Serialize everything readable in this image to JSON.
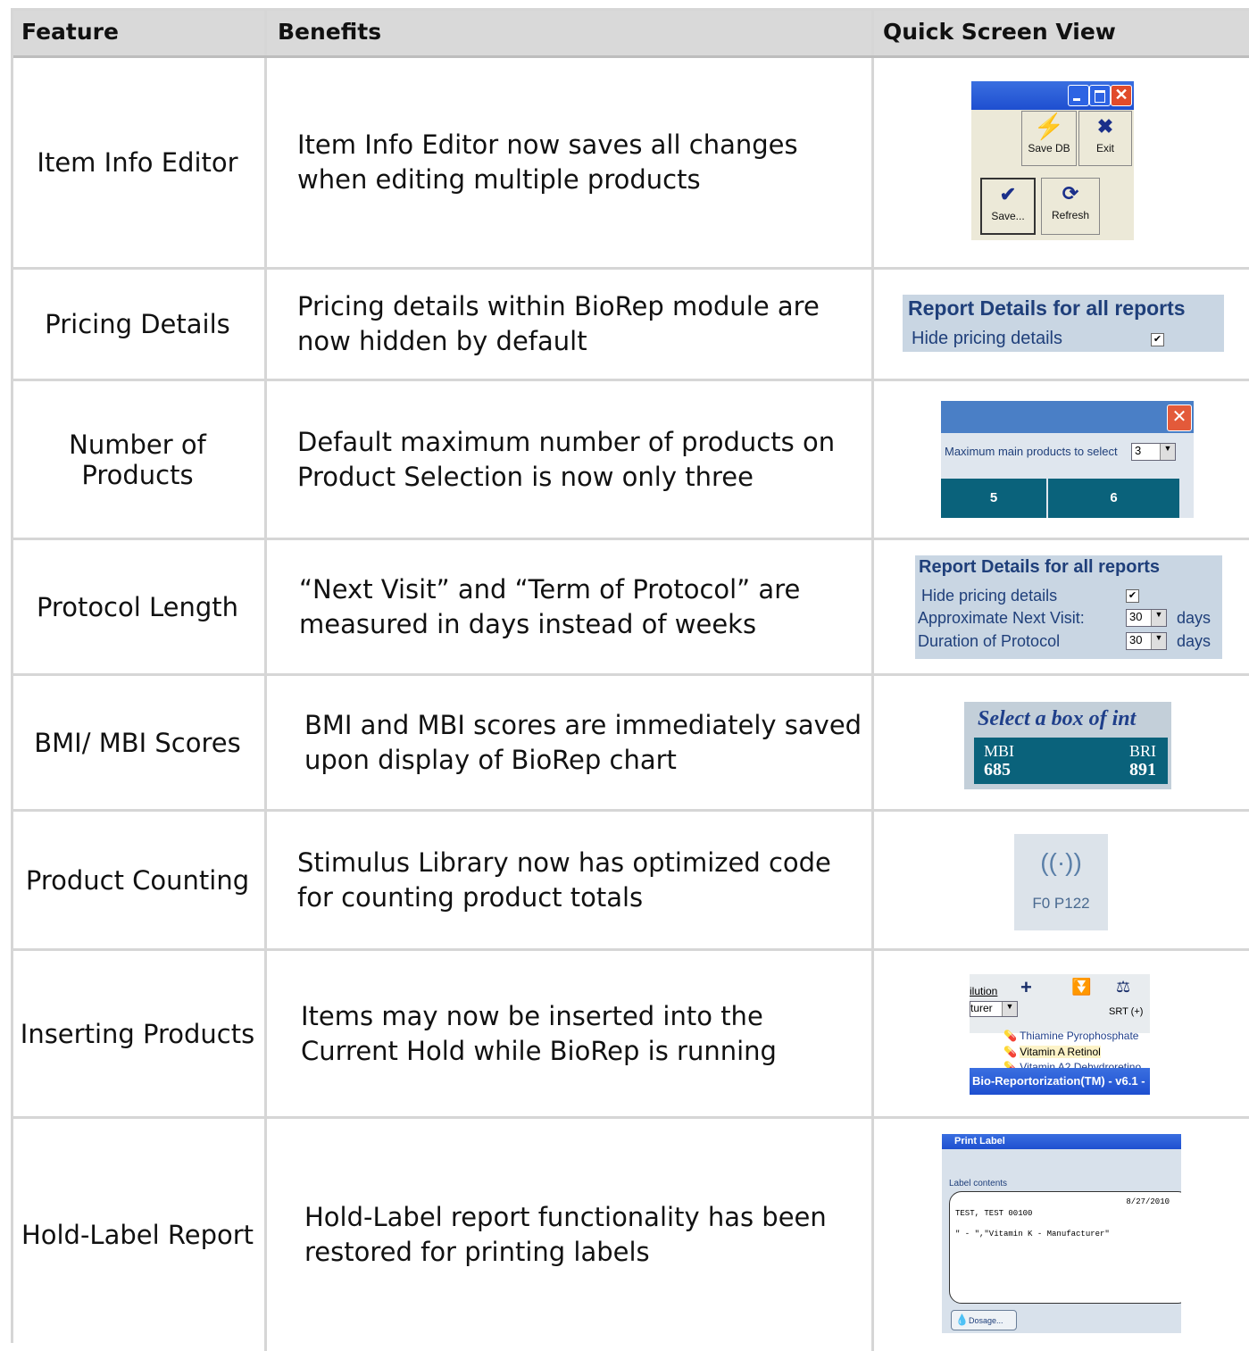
{
  "header": {
    "feature": "Feature",
    "benefits": "Benefits",
    "quick": "Quick Screen View"
  },
  "rows": [
    {
      "feature": "Item Info Editor",
      "benefit": "Item Info Editor now saves all changes when editing multiple products"
    },
    {
      "feature": "Pricing Details",
      "benefit": "Pricing details within BioRep module are now hidden by default"
    },
    {
      "feature": "Number of Products",
      "benefit": "Default maximum number of products on Product Selection is now only three"
    },
    {
      "feature": "Protocol Length",
      "benefit": "“Next Visit” and “Term of Protocol” are measured in days instead of weeks"
    },
    {
      "feature": "BMI/ MBI Scores",
      "benefit": "BMI and MBI scores are immediately saved upon display of BioRep chart"
    },
    {
      "feature": "Product Counting",
      "benefit": "Stimulus Library now has optimized code for counting product totals"
    },
    {
      "feature": "Inserting Products",
      "benefit": "Items may now be inserted into the Current Hold while BioRep is running"
    },
    {
      "feature": "Hold-Label Report",
      "benefit": "Hold-Label report functionality has been restored for printing labels"
    }
  ],
  "shots": {
    "editor": {
      "save_db": "Save DB",
      "exit": "Exit",
      "save": "Save...",
      "refresh": "Refresh"
    },
    "pricing": {
      "title": "Report Details for all reports",
      "hide": "Hide pricing details",
      "check": "✔"
    },
    "products": {
      "label": "Maximum main products to select",
      "value": "3",
      "col5": "5",
      "col6": "6"
    },
    "protocol": {
      "title": "Report Details for all reports",
      "hide": "Hide pricing details",
      "next": "Approximate Next Visit:",
      "duration": "Duration of Protocol",
      "next_val": "30",
      "dur_val": "30",
      "days": "days"
    },
    "bmi": {
      "title": "Select a box of int",
      "mbi_label": "MBI",
      "bri_label": "BRI",
      "mbi_val": "685",
      "bri_val": "891"
    },
    "counting": {
      "text": "F0 P122"
    },
    "inserting": {
      "dilution": "ilution",
      "turer": "turer",
      "srt": "SRT (+)",
      "item1": "Thiamine Pyrophosphate",
      "item2": "Vitamin A Retinol",
      "item3": "Vitamin A2 Dehydroretino",
      "title": "Bio-Reportorization(TM) - v6.1 -"
    },
    "label": {
      "title": "Print Label",
      "contents": "Label contents",
      "date": "8/27/2010",
      "line1": "TEST, TEST 00100",
      "line2": "\" - \",\"Vitamin K - Manufacturer\"",
      "dosage": "Dosage..."
    }
  }
}
